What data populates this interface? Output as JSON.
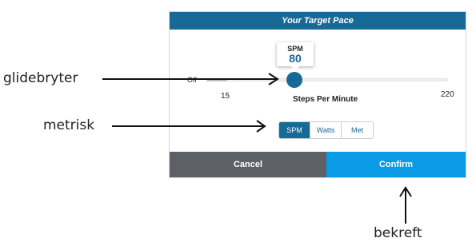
{
  "dialog": {
    "title": "Your Target Pace",
    "slider": {
      "off_label": "Off",
      "value_unit": "SPM",
      "value": "80",
      "min_label": "15",
      "max_label": "220",
      "axis_label": "Steps Per Minute"
    },
    "metric_options": [
      {
        "label": "SPM",
        "selected": true
      },
      {
        "label": "Watts",
        "selected": false
      },
      {
        "label": "Met",
        "selected": false
      }
    ],
    "buttons": {
      "cancel": "Cancel",
      "confirm": "Confirm"
    }
  },
  "annotations": {
    "slider": "glidebryter",
    "metric": "metrisk",
    "confirm": "bekreft"
  },
  "colors": {
    "accent": "#186a96",
    "confirm": "#0b9be6",
    "cancel": "#5d6167"
  }
}
